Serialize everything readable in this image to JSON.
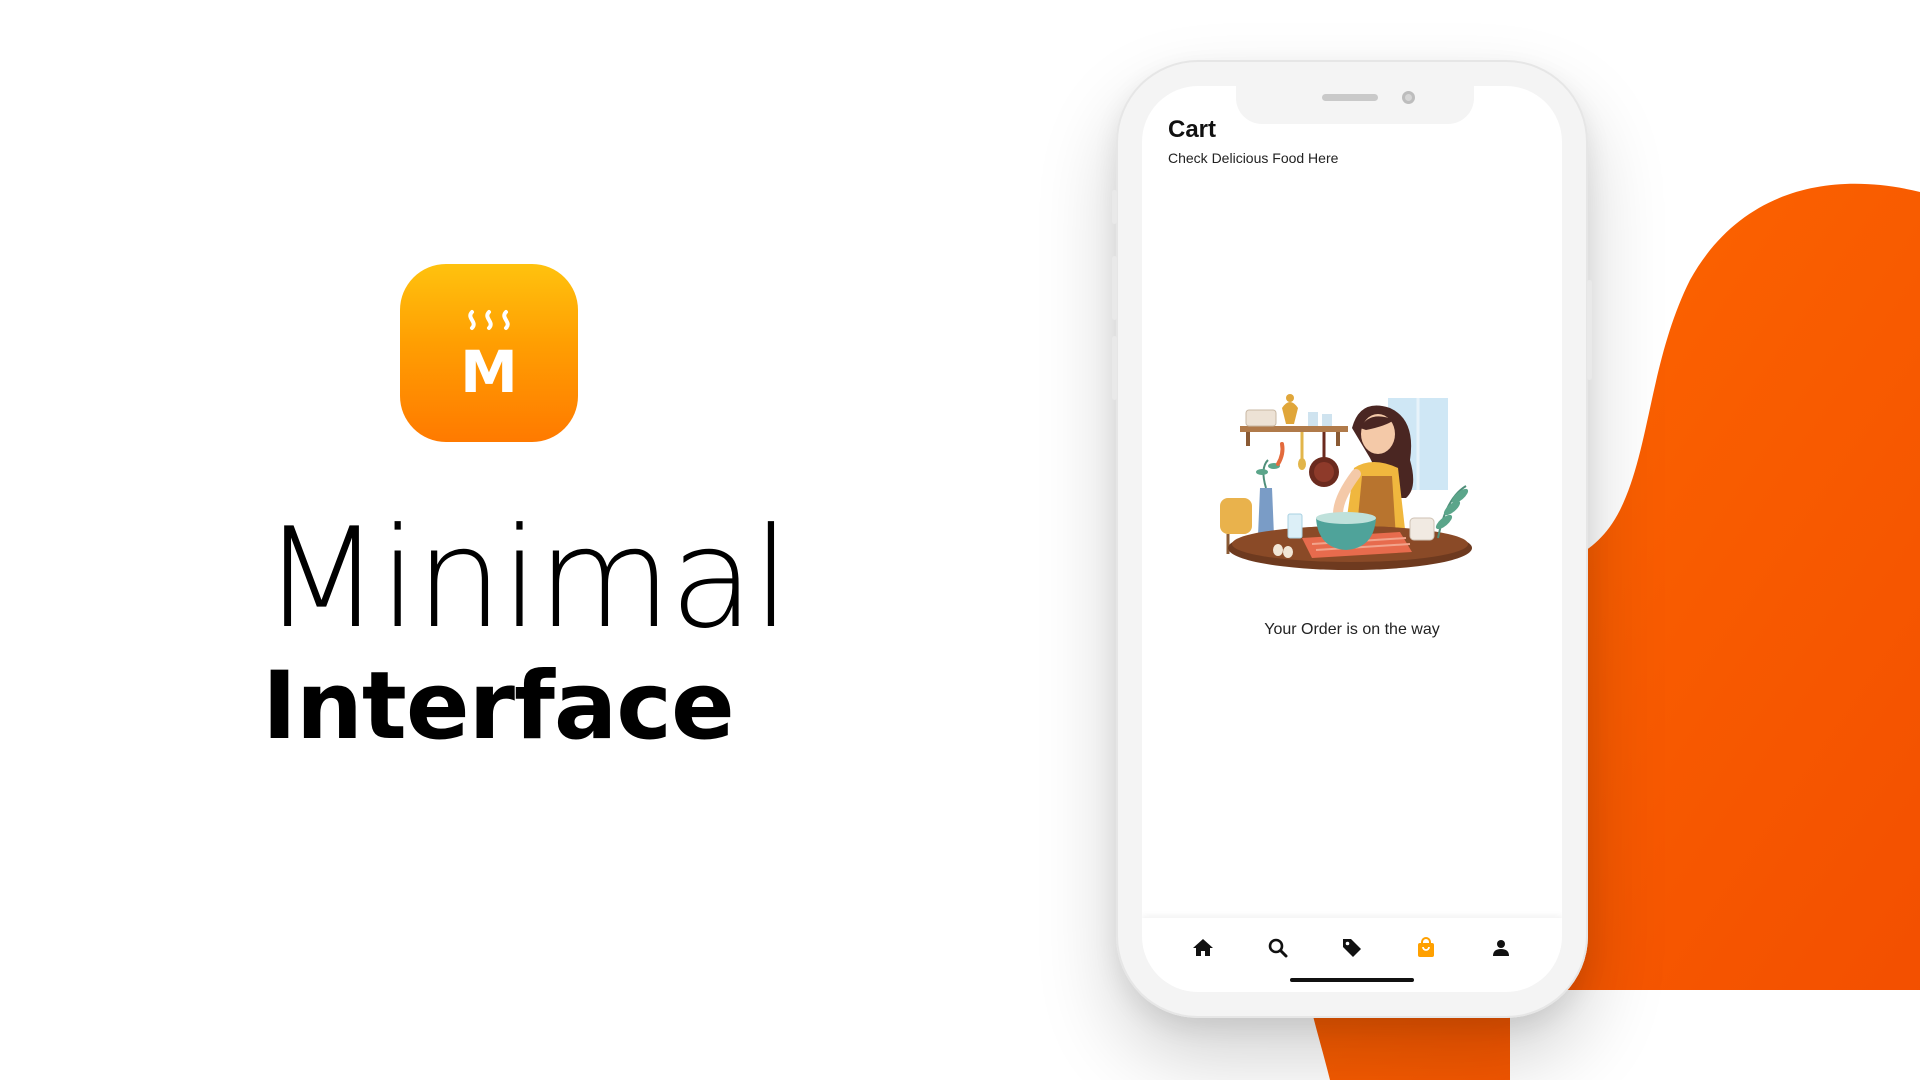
{
  "brand": {
    "logo_letter": "M",
    "title_light": "Minimal",
    "title_bold": "Interface"
  },
  "screen": {
    "header": {
      "title": "Cart",
      "subtitle": "Check Delicious Food Here"
    },
    "status_text": "Your Order is on the way",
    "nav": [
      {
        "icon": "home-icon",
        "active": false
      },
      {
        "icon": "search-icon",
        "active": false
      },
      {
        "icon": "tag-icon",
        "active": false
      },
      {
        "icon": "shopping-bag-icon",
        "active": true
      },
      {
        "icon": "person-icon",
        "active": false
      }
    ]
  },
  "colors": {
    "accent": "#FF5A00",
    "icon_gradient_top": "#FFC20E",
    "icon_gradient_bottom": "#FF7A00",
    "nav_active": "#FFA000",
    "nav_inactive": "#111111"
  }
}
